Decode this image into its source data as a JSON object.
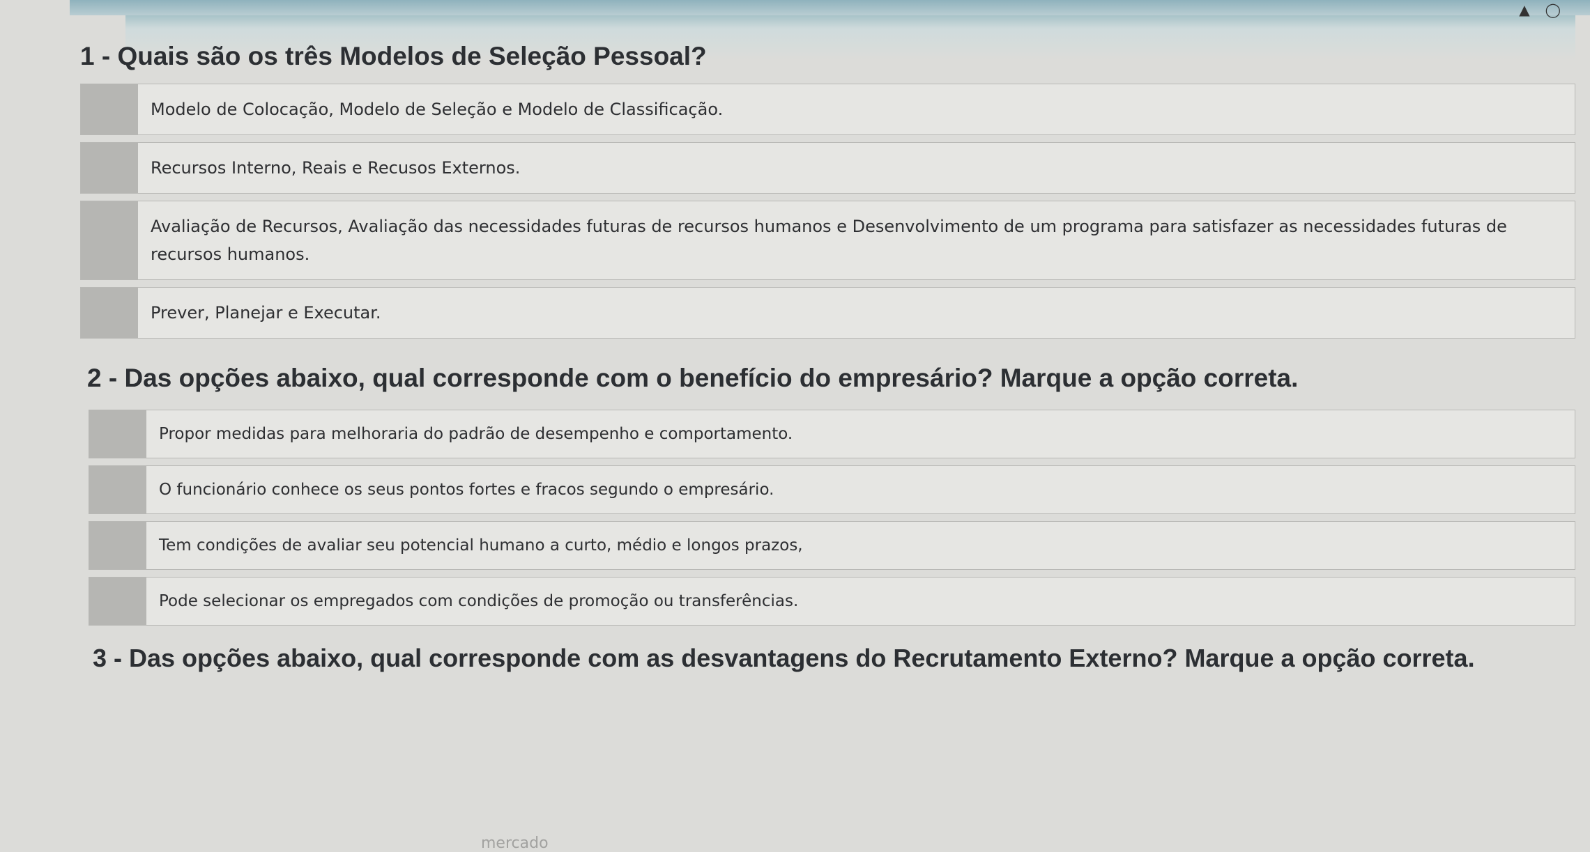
{
  "questions": [
    {
      "title": "1 - Quais são os três Modelos de Seleção Pessoal?",
      "options": [
        "Modelo de Colocação, Modelo de Seleção e Modelo de Classificação.",
        "Recursos Interno, Reais e Recusos Externos.",
        "Avaliação de Recursos, Avaliação das necessidades futuras de recursos humanos e Desenvolvimento de um programa para satisfazer as necessidades futuras de recursos humanos.",
        "Prever, Planejar e Executar."
      ]
    },
    {
      "title": "2 - Das opções abaixo, qual corresponde com o benefício do empresário? Marque a opção correta.",
      "options": [
        "Propor medidas para melhoraria do padrão de desempenho e comportamento.",
        "O funcionário conhece os seus pontos fortes e fracos segundo o empresário.",
        "Tem condições de avaliar seu potencial humano a curto, médio e longos prazos,",
        "Pode selecionar os empregados com condições de promoção ou transferências."
      ]
    },
    {
      "title": "3 - Das opções abaixo, qual corresponde com as desvantagens do Recrutamento Externo? Marque a opção correta."
    }
  ],
  "footer": {
    "partial_text": "mercado"
  },
  "colors": {
    "background": "#dcdcd9",
    "option_background": "#e6e6e3",
    "radio_box": "#b6b6b3",
    "top_bar": "#8fb2bd"
  }
}
